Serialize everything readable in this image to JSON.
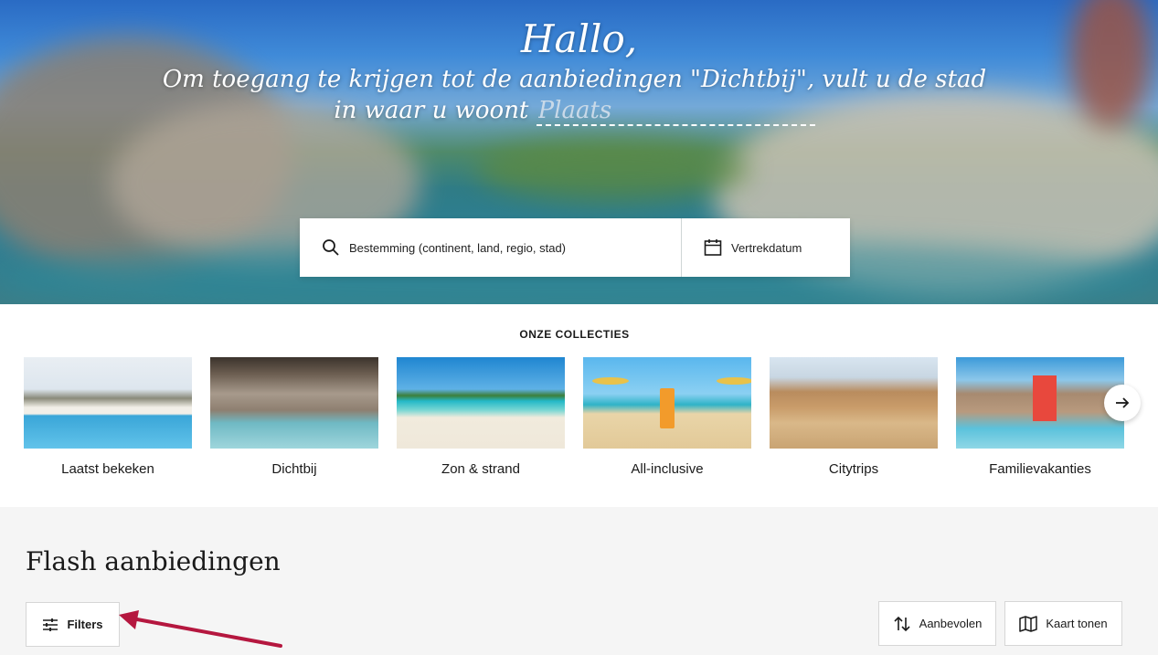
{
  "hero": {
    "greeting": "Hallo,",
    "subtitle": "Om toegang te krijgen tot de aanbiedingen \"Dichtbij\", vult u de stad in waar u woont",
    "place_placeholder": "Plaats"
  },
  "search": {
    "destination_placeholder": "Bestemming (continent, land, regio, stad)",
    "date_label": "Vertrekdatum"
  },
  "collections": {
    "title": "ONZE COLLECTIES",
    "items": [
      {
        "label": "Laatst bekeken"
      },
      {
        "label": "Dichtbij"
      },
      {
        "label": "Zon & strand"
      },
      {
        "label": "All-inclusive"
      },
      {
        "label": "Citytrips"
      },
      {
        "label": "Familievakanties"
      }
    ]
  },
  "flash": {
    "title": "Flash aanbiedingen",
    "filters_label": "Filters",
    "sort_label": "Aanbevolen",
    "map_label": "Kaart tonen"
  },
  "colors": {
    "annotation_arrow": "#b5173f"
  }
}
